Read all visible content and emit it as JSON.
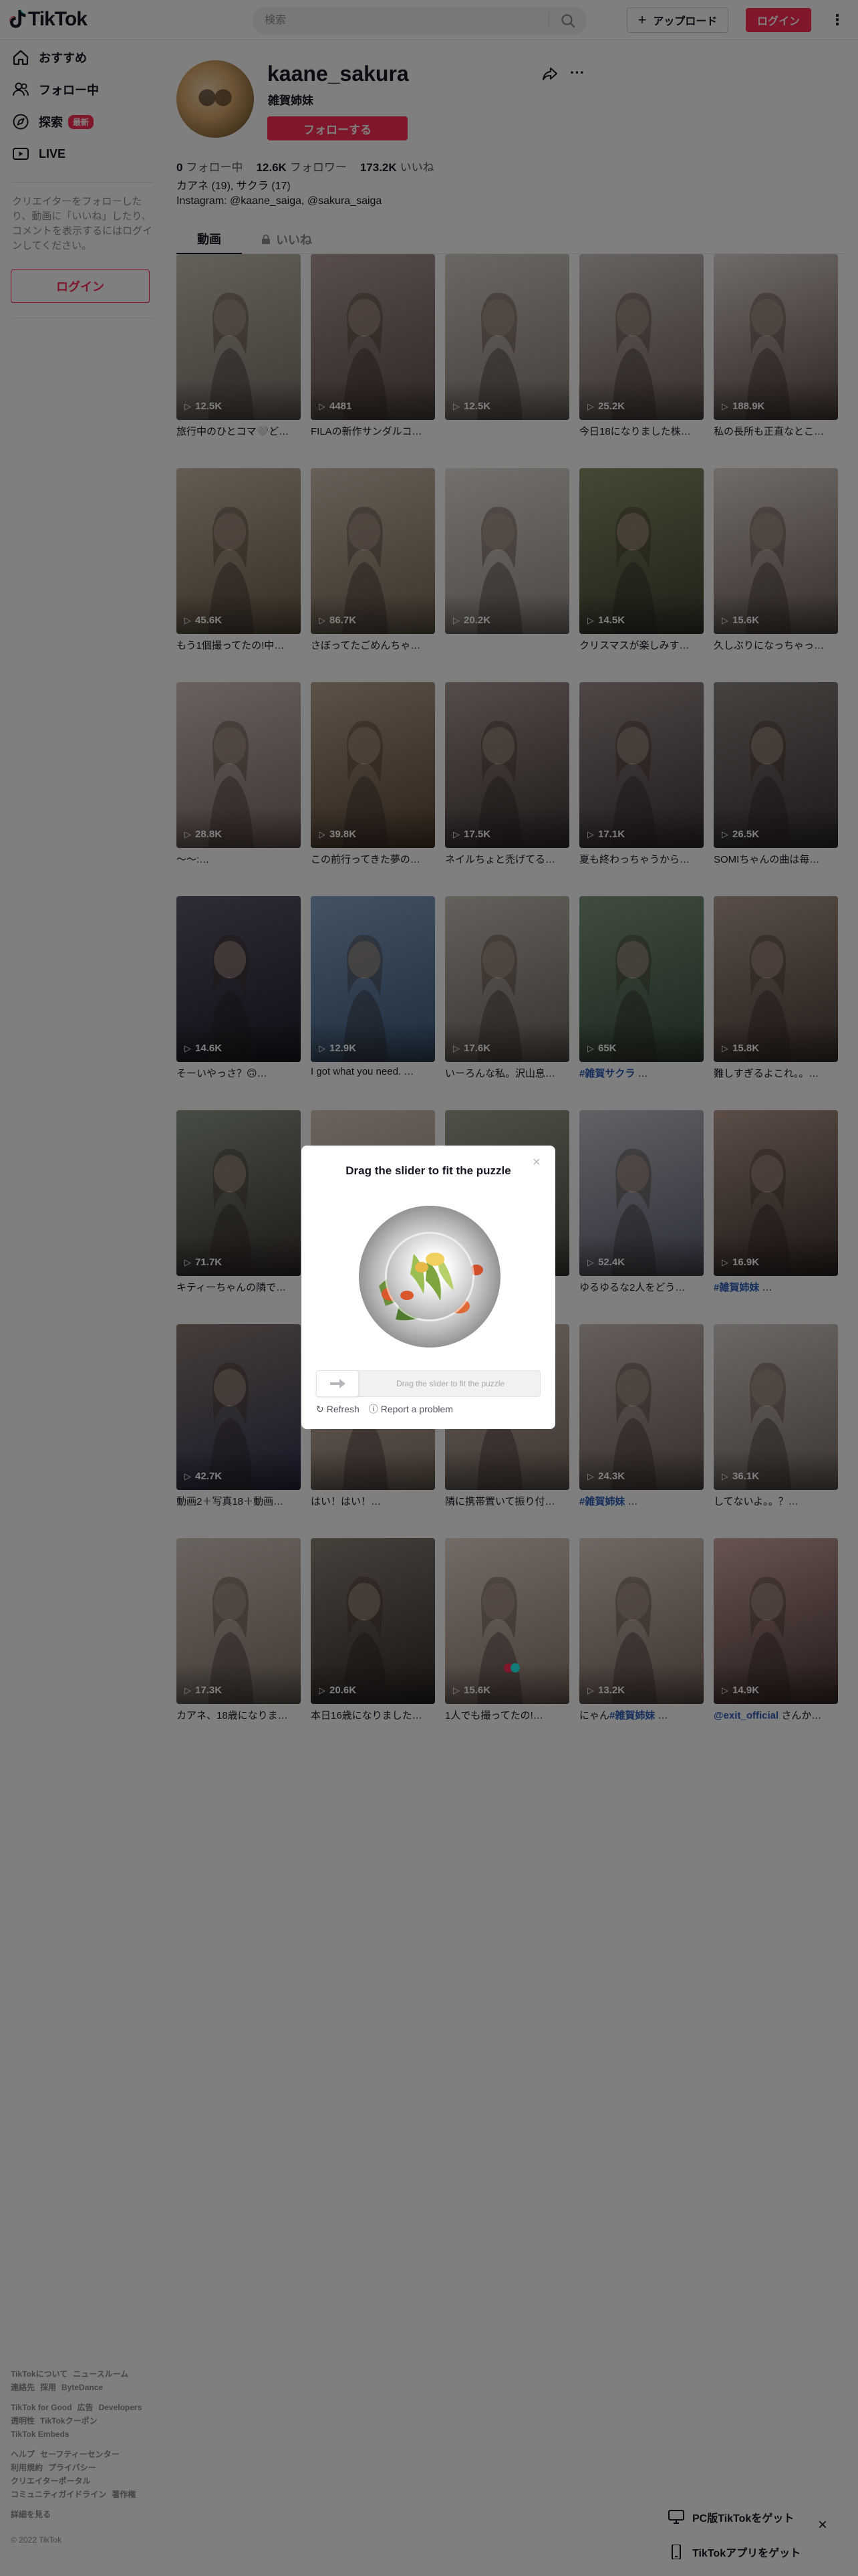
{
  "header": {
    "logo_text": "TikTok",
    "search_placeholder": "検索",
    "upload_label": "アップロード",
    "login_label": "ログイン"
  },
  "sidebar": {
    "items": [
      {
        "label": "おすすめ",
        "icon": "home-icon"
      },
      {
        "label": "フォロー中",
        "icon": "following-icon"
      },
      {
        "label": "探索",
        "icon": "explore-icon",
        "badge": "最新"
      },
      {
        "label": "LIVE",
        "icon": "live-icon"
      }
    ],
    "description": "クリエイターをフォローしたり、動画に「いいね」したり、コメントを表示するにはログインしてください。",
    "login_label": "ログイン"
  },
  "profile": {
    "username": "kaane_sakura",
    "nickname": "雑賀姉妹",
    "follow_label": "フォローする",
    "following_count": "0",
    "following_label": "フォロー中",
    "followers_count": "12.6K",
    "followers_label": "フォロワー",
    "likes_count": "173.2K",
    "likes_label": "いいね",
    "bio_line1": "カアネ (19), サクラ (17)",
    "bio_line2": "Instagram: @kaane_saiga, @sakura_saiga",
    "tab_videos": "動画",
    "tab_liked": "いいね"
  },
  "videos": [
    {
      "views": "12.5K",
      "caption": "旅行中のひとコマ🤍ど…",
      "colors": [
        "#c9c0b4",
        "#7d7468"
      ]
    },
    {
      "views": "4481",
      "caption": "FILAの新作サンダルコ…",
      "colors": [
        "#b29c97",
        "#5f5148"
      ]
    },
    {
      "views": "12.5K",
      "caption": "",
      "colors": [
        "#d6cfc7",
        "#8b7f74"
      ]
    },
    {
      "views": "25.2K",
      "caption": "今日18になりました株…",
      "colors": [
        "#cfc6c2",
        "#6f5f58"
      ]
    },
    {
      "views": "188.9K",
      "caption": "私の長所も正直なとこ…",
      "colors": [
        "#e0d6d2",
        "#5d4c46"
      ]
    },
    {
      "views": "45.6K",
      "caption": "もう1個撮ってたの!中…",
      "colors": [
        "#c7b9a6",
        "#6e5e48"
      ]
    },
    {
      "views": "86.7K",
      "caption": "さぼってたごめんちゃ…",
      "colors": [
        "#cdbfae",
        "#7a6a56"
      ]
    },
    {
      "views": "20.2K",
      "caption": "",
      "colors": [
        "#e7e1da",
        "#9b9088"
      ]
    },
    {
      "views": "14.5K",
      "caption": "クリスマスが楽しみす…",
      "colors": [
        "#8a9168",
        "#3d4530"
      ]
    },
    {
      "views": "15.6K",
      "caption": "久しぶりになっちゃっ…",
      "colors": [
        "#e3d8d1",
        "#6b5d56"
      ]
    },
    {
      "views": "28.8K",
      "caption": "～～:…",
      "colors": [
        "#d3c3bc",
        "#7e6a64"
      ]
    },
    {
      "views": "39.8K",
      "caption": "この前行ってきた夢の…",
      "colors": [
        "#b9a48f",
        "#5c4634"
      ]
    },
    {
      "views": "17.5K",
      "caption": "ネイルちょと禿げてる…",
      "colors": [
        "#a99a94",
        "#3f3534"
      ]
    },
    {
      "views": "17.1K",
      "caption": "夏も終わっちゃうから…",
      "colors": [
        "#9d8f8c",
        "#40353a"
      ]
    },
    {
      "views": "26.5K",
      "caption": "SOMIちゃんの曲は毎…",
      "colors": [
        "#8f8682",
        "#3b3333"
      ]
    },
    {
      "views": "14.6K",
      "caption": "そーいやっさ？🙃…",
      "colors": [
        "#5d5a6e",
        "#1f1d2a"
      ]
    },
    {
      "views": "12.9K",
      "caption": "I got what you need. …",
      "colors": [
        "#86a6c9",
        "#3d5c7c"
      ]
    },
    {
      "views": "17.6K",
      "caption": "いーろんな私。沢山息…",
      "colors": [
        "#c9c1b6",
        "#6f665c"
      ]
    },
    {
      "views": "65K",
      "caption": "",
      "tag": "#雑賀サクラ",
      "caption_rest": " …",
      "colors": [
        "#7f9a7e",
        "#39503c"
      ]
    },
    {
      "views": "15.8K",
      "caption": "難しすぎるよこれ。。…",
      "colors": [
        "#b39e90",
        "#4a3c34"
      ]
    },
    {
      "views": "71.7K",
      "caption": "キティーちゃんの隣で…",
      "colors": [
        "#8e9a88",
        "#3d3432"
      ]
    },
    {
      "views": "",
      "caption": "",
      "colors": [
        "#d7c9bd",
        "#8a7b70"
      ]
    },
    {
      "views": "",
      "caption": "",
      "colors": [
        "#9fa290",
        "#4a4a3e"
      ]
    },
    {
      "views": "52.4K",
      "caption": "ゆるゆるな2人をどう…",
      "colors": [
        "#c2c4cd",
        "#5d6070"
      ]
    },
    {
      "views": "16.9K",
      "caption": "",
      "tag": "#雑賀姉妹",
      "caption_rest": " …",
      "colors": [
        "#b89c8e",
        "#3a2e2a"
      ]
    },
    {
      "views": "42.7K",
      "caption": "動画2＋写真18＋動画…",
      "colors": [
        "#8c7b72",
        "#2f3354"
      ]
    },
    {
      "views": "",
      "caption": "はい！はい！…",
      "colors": [
        "#d8c8bb",
        "#887666"
      ]
    },
    {
      "views": "",
      "caption": "隣に携帯置いて振り付…",
      "colors": [
        "#cdbfb3",
        "#7f6f63"
      ]
    },
    {
      "views": "24.3K",
      "caption": "",
      "tag": "#雑賀姉妹",
      "caption_rest": " …",
      "colors": [
        "#cbbfb8",
        "#6d5e57"
      ]
    },
    {
      "views": "36.1K",
      "caption": "してないよ。。？…",
      "colors": [
        "#d9d0c9",
        "#7c6f68"
      ]
    },
    {
      "views": "17.3K",
      "caption": "カアネ、18歳になりま…",
      "colors": [
        "#d5c9c0",
        "#847669"
      ]
    },
    {
      "views": "20.6K",
      "caption": "本日16歳になりました…",
      "colors": [
        "#8f8378",
        "#302a26"
      ]
    },
    {
      "views": "15.6K",
      "caption": "1人でも撮ってたの!…",
      "colors": [
        "#e4d6cc",
        "#8d786b"
      ]
    },
    {
      "views": "13.2K",
      "caption": "にゃん",
      "tag": "#雑賀姉妹",
      "caption_rest": " …",
      "colors": [
        "#dfd0c6",
        "#7d6a5e"
      ]
    },
    {
      "views": "14.9K",
      "caption": "",
      "tag": "@exit_official",
      "caption_rest": " さんか…",
      "colors": [
        "#cfa9a0",
        "#4b3634"
      ]
    }
  ],
  "footer": {
    "line1": [
      "TikTokについて",
      "ニュースルーム"
    ],
    "line2": [
      "連絡先",
      "採用",
      "ByteDance"
    ],
    "line3": [
      "TikTok for Good",
      "広告",
      "Developers"
    ],
    "line4": [
      "透明性",
      "TikTokクーポン"
    ],
    "line5": [
      "TikTok Embeds"
    ],
    "line6": [
      "ヘルプ",
      "セーフティーセンター"
    ],
    "line7": [
      "利用規約",
      "プライバシー"
    ],
    "line8": [
      "クリエイターポータル"
    ],
    "line9": [
      "コミュニティガイドライン",
      "著作権"
    ],
    "more": "詳細を見る",
    "copyright": "© 2022 TikTok"
  },
  "app_prompts": {
    "pc_label": "PC版TikTokをゲット",
    "app_label": "TikTokアプリをゲット"
  },
  "captcha": {
    "title": "Drag the slider to fit the puzzle",
    "slider_text": "Drag the slider to fit the puzzle",
    "refresh_label": "Refresh",
    "report_label": "Report a problem"
  },
  "colors": {
    "brand": "#fe2c55",
    "tag": "#2b5db9",
    "loader_red": "#fe2c55",
    "loader_cyan": "#25f4ee"
  }
}
